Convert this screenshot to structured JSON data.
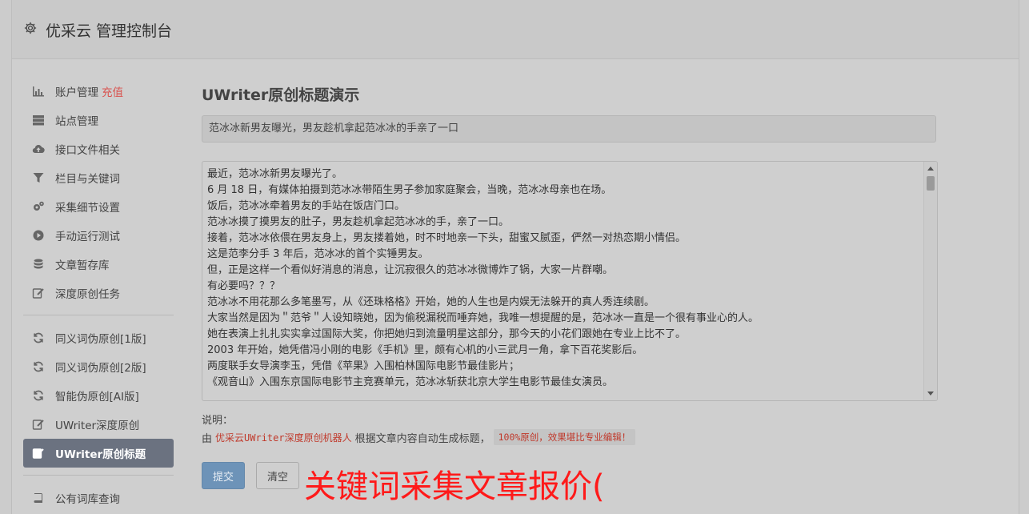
{
  "header": {
    "title": "优采云 管理控制台",
    "icon": "gear-icon"
  },
  "sidebar": {
    "group1": [
      {
        "label": "账户管理",
        "badge": "充值",
        "icon": "bar-chart-icon"
      },
      {
        "label": "站点管理",
        "icon": "server-icon"
      },
      {
        "label": "接口文件相关",
        "icon": "cloud-upload-icon"
      },
      {
        "label": "栏目与关键词",
        "icon": "filter-icon"
      },
      {
        "label": "采集细节设置",
        "icon": "cogs-icon"
      },
      {
        "label": "手动运行测试",
        "icon": "play-circle-icon"
      },
      {
        "label": "文章暂存库",
        "icon": "database-icon"
      },
      {
        "label": "深度原创任务",
        "icon": "edit-icon"
      }
    ],
    "group2": [
      {
        "label": "同义词伪原创[1版]",
        "icon": "refresh-icon"
      },
      {
        "label": "同义词伪原创[2版]",
        "icon": "refresh-icon"
      },
      {
        "label": "智能伪原创[AI版]",
        "icon": "refresh-icon"
      },
      {
        "label": "UWriter深度原创",
        "icon": "edit-icon"
      },
      {
        "label": "UWriter原创标题",
        "icon": "edit-icon",
        "active": true
      }
    ],
    "group3": [
      {
        "label": "公有词库查询",
        "icon": "book-icon"
      }
    ]
  },
  "main": {
    "title": "UWriter原创标题演示",
    "title_input_value": "范冰冰新男友曝光，男友趁机拿起范冰冰的手亲了一口",
    "content_lines": [
      "最近，范冰冰新男友曝光了。",
      "6 月 18 日，有媒体拍摄到范冰冰带陌生男子参加家庭聚会，当晚，范冰冰母亲也在场。",
      "饭后，范冰冰牵着男友的手站在饭店门口。",
      "范冰冰摸了摸男友的肚子，男友趁机拿起范冰冰的手，亲了一口。",
      "接着，范冰冰依偎在男友身上，男友搂着她，时不时地亲一下头，甜蜜又腻歪，俨然一对热恋期小情侣。",
      "这是范李分手 3 年后，范冰冰的首个实锤男友。",
      "但，正是这样一个看似好消息的消息，让沉寂很久的范冰冰微博炸了锅，大家一片群嘲。",
      "有必要吗？？？",
      "范冰冰不用花那么多笔墨写，从《还珠格格》开始，她的人生也是内娱无法躲开的真人秀连续剧。",
      "大家当然是因为＂范爷＂人设知晓她，因为偷税漏税而唾弃她，我唯一想提醒的是，范冰冰一直是一个很有事业心的人。",
      "她在表演上扎扎实实拿过国际大奖，你把她归到流量明星这部分，那今天的小花们跟她在专业上比不了。",
      "2003 年开始，她凭借冯小刚的电影《手机》里，颇有心机的小三武月一角，拿下百花奖影后。",
      "两度联手女导演李玉，凭借《苹果》入围柏林国际电影节最佳影片；",
      "《观音山》入围东京国际电影节主竞赛单元，范冰冰斩获北京大学生电影节最佳女演员。"
    ],
    "note_label": "说明：",
    "note_prefix": "由",
    "note_link": "优采云UWriter深度原创机器人",
    "note_middle": "根据文章内容自动生成标题，",
    "note_code": "100%原创，效果堪比专业编辑！",
    "submit_label": "提交",
    "clear_label": "清空",
    "overlay_text": "关键词采集文章报价("
  },
  "colors": {
    "accent_red": "#ff1a1a",
    "active_nav": "#6b7280",
    "submit_button": "#6d93b8",
    "badge": "#d9534f"
  }
}
